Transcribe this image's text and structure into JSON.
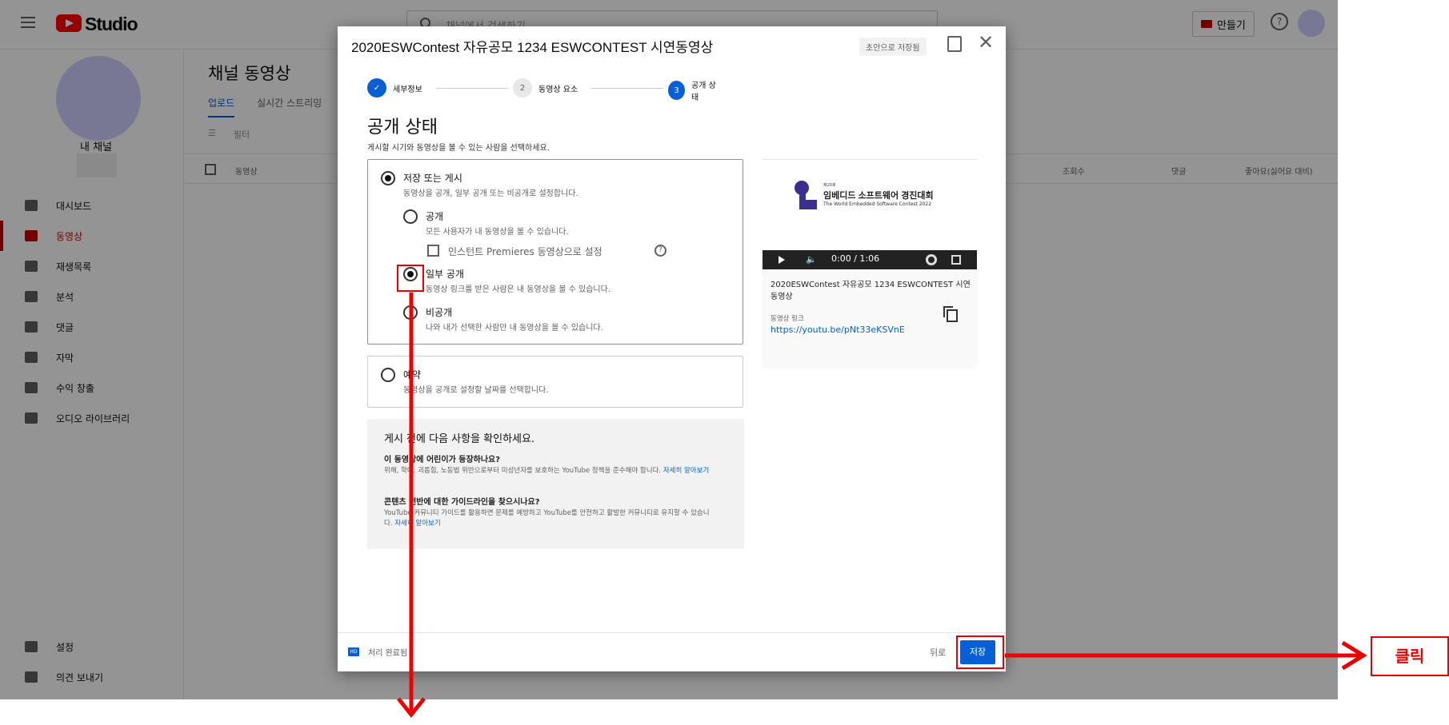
{
  "app": {
    "brand": "Studio",
    "search_placeholder": "채널에서 검색하기",
    "create_label": "만들기",
    "help_glyph": "?"
  },
  "sidebar": {
    "channel_label": "내 채널",
    "items": [
      {
        "label": "대시보드",
        "icon": "dashboard-icon"
      },
      {
        "label": "동영상",
        "icon": "video-icon",
        "active": true
      },
      {
        "label": "재생목록",
        "icon": "playlist-icon"
      },
      {
        "label": "분석",
        "icon": "analytics-icon"
      },
      {
        "label": "댓글",
        "icon": "comments-icon"
      },
      {
        "label": "자막",
        "icon": "subtitles-icon"
      },
      {
        "label": "수익 창출",
        "icon": "dollar-icon"
      },
      {
        "label": "오디오 라이브러리",
        "icon": "audio-library-icon"
      }
    ],
    "settings_label": "설정",
    "feedback_label": "의견 보내기"
  },
  "main": {
    "title": "채널 동영상",
    "tabs": [
      "업로드",
      "실시간 스트리밍"
    ],
    "filter_label": "필터",
    "columns": [
      "동영상",
      "조회수",
      "댓글",
      "좋아요(싫어요 대비)"
    ]
  },
  "dialog": {
    "title": "2020ESWContest 자유공모 1234 ESWCONTEST 시연동영상",
    "draft_chip": "초안으로 저장됨",
    "close_glyph": "✕",
    "steps": [
      {
        "num": "✓",
        "label": "세부정보"
      },
      {
        "num": "2",
        "label": "동영상 요소"
      },
      {
        "num": "3",
        "label": "공개 상태"
      }
    ],
    "section_title": "공개 상태",
    "section_sub": "게시할 시기와 동영상을 볼 수 있는 사람을 선택하세요.",
    "save_or_publish": {
      "label": "저장 또는 게시",
      "desc": "동영상을 공개, 일부 공개 또는 비공개로 설정합니다.",
      "public_label": "공개",
      "public_desc": "모든 사용자가 내 동영상을 볼 수 있습니다.",
      "premiere_label": "인스턴트 Premieres 동영상으로 설정",
      "unlisted_label": "일부 공개",
      "unlisted_desc": "동영상 링크를 받은 사람은 내 동영상을 볼 수 있습니다.",
      "private_label": "비공개",
      "private_desc": "나와 내가 선택한 사람만 내 동영상을 볼 수 있습니다.",
      "selected": "일부 공개"
    },
    "schedule": {
      "label": "예약",
      "desc": "동영상을 공개로 설정할 날짜를 선택합니다."
    },
    "checklist": {
      "title": "게시 전에 다음 사항을 확인하세요.",
      "q1": "이 동영상에 어린이가 등장하나요?",
      "p1": "위해, 학대, 괴롭힘, 노동법 위반으로부터 미성년자를 보호하는 YouTube 정책을 준수해야 합니다.",
      "link1": "자세히 알아보기",
      "q2": "콘텐츠 전반에 대한 가이드라인을 찾으시나요?",
      "p2": "YouTube 커뮤니티 가이드를 활용하면 문제를 예방하고 YouTube를 안전하고 활발한 커뮤니티로 유지할 수 있습니다.",
      "link2": "자세히 알아보기"
    },
    "preview": {
      "logo_small": "제20회",
      "logo_name": "임베디드 소프트웨어 경진대회",
      "logo_en": "The World Embedded Software Contest 2022",
      "time": "0:00 / 1:06",
      "video_title": "2020ESWContest 자유공모 1234 ESWCONTEST 시연동영상",
      "link_label": "동영상 링크",
      "link": "https://youtu.be/pNt33eKSVnE"
    },
    "footer": {
      "hd": "HD",
      "status": "처리 완료됨",
      "back": "뒤로",
      "save": "저장"
    }
  },
  "annotation": {
    "click_label": "클릭",
    "color": "#e00000"
  }
}
